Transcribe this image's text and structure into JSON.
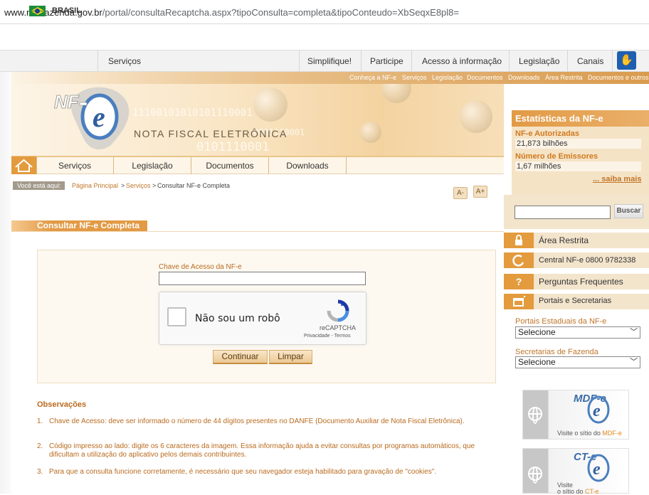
{
  "browser": {
    "url_host": "www.nfe.fazenda.gov.br",
    "url_path": "/portal/consultaRecaptcha.aspx?tipoConsulta=completa&tipoConteudo=XbSeqxE8pl8="
  },
  "govbar": {
    "country": "BRASIL",
    "services": "Serviços",
    "links": [
      "Simplifique!",
      "Participe",
      "Acesso à informação",
      "Legislação",
      "Canais"
    ]
  },
  "toplinks": [
    "Conheça a NF-e",
    "Serviços",
    "Legislação",
    "Documentos",
    "Downloads",
    "Área Restrita",
    "Documentos e outros"
  ],
  "header": {
    "logo_text": "NF-e",
    "title": "NOTA FISCAL ELETRÔNICA",
    "binary_1": "11100101010101110001",
    "binary_2": "0101110001",
    "binary_3": "0001110001"
  },
  "nav": {
    "items": [
      "Serviços",
      "Legislação",
      "Documentos",
      "Downloads"
    ]
  },
  "breadcrumb": {
    "label": "Você está aqui:",
    "home": "Página Principal",
    "sep": ">",
    "services": "Serviços",
    "current": "Consultar NF-e Completa"
  },
  "font_controls": {
    "decrease": "A-",
    "increase": "A+"
  },
  "page_title": "Consultar NF-e Completa",
  "form": {
    "key_label": "Chave de Acesso da NF-e",
    "key_value": "",
    "captcha_text": "Não sou um robô",
    "captcha_brand": "reCAPTCHA",
    "captcha_links": "Privacidade - Termos",
    "continue_label": "Continuar",
    "clear_label": "Limpar"
  },
  "observations": {
    "title": "Observações",
    "items": [
      {
        "n": "1.",
        "text": "Chave de Acesso: deve ser informado o número de 44 dígitos presentes no DANFE (Documento Auxiliar de Nota Fiscal Eletrônica)."
      },
      {
        "n": "2.",
        "text": "Código impresso ao lado: digite os 6 caracteres da imagem. Essa informação ajuda a evitar consultas por programas automáticos, que dificultam a utilização do aplicativo pelos demais contribuintes."
      },
      {
        "n": "3.",
        "text": "Para que a consulta funcione corretamente, é necessário que seu navegador esteja habilitado para gravação de \"cookies\"."
      }
    ]
  },
  "stats": {
    "title": "Estatísticas da NF-e",
    "authorized_label": "NF-e Autorizadas",
    "authorized_value": "21,873 bilhões",
    "issuers_label": "Número de Emissores",
    "issuers_value": "1,67 milhões",
    "more": "... saiba mais"
  },
  "search": {
    "value": "",
    "button": "Buscar"
  },
  "sidebar": {
    "links": [
      {
        "label": "Área Restrita",
        "icon": "lock-icon"
      },
      {
        "label": "Central NF-e 0800 9782338",
        "icon": "phone-icon"
      },
      {
        "label": "Perguntas Frequentes",
        "icon": "question-icon"
      },
      {
        "label": "Portais e Secretarias",
        "icon": "window-icon"
      }
    ],
    "portais_label": "Portais Estaduais da NF-e",
    "portais_value": "Selecione",
    "secretarias_label": "Secretarias de Fazenda",
    "secretarias_value": "Selecione"
  },
  "cards": [
    {
      "logo": "MDF-e",
      "text_prefix": "Visite o sítio do ",
      "text_accent": "MDF-e"
    },
    {
      "logo": "CT-e",
      "text_prefix": "Visite",
      "text_line2_prefix": "o sítio do ",
      "text_accent": "CT-e"
    }
  ],
  "colors": {
    "accent": "#e29a45",
    "link": "#c0762a",
    "panel": "#f3e4cc"
  }
}
